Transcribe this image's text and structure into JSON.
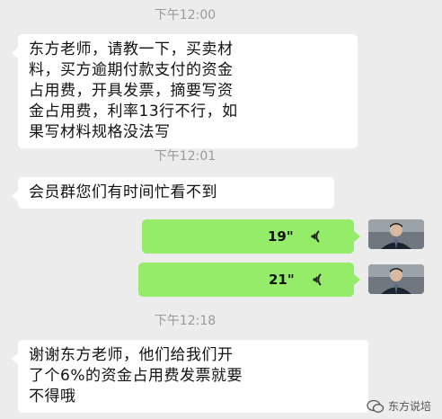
{
  "messages": [
    {
      "type": "time",
      "text": "下午12:00"
    },
    {
      "type": "text_in",
      "lines": [
        "东方老师，请教一下，买卖材",
        "料，买方逾期付款支付的资金",
        "占用费，开具发票，摘要写资",
        "金占用费，利率13行不行，如",
        "果写材料规格没法写"
      ]
    },
    {
      "type": "time",
      "text": "下午12:01"
    },
    {
      "type": "text_in",
      "lines": [
        "会员群您们有时间忙看不到"
      ]
    },
    {
      "type": "voice_out",
      "duration": "19\""
    },
    {
      "type": "voice_out",
      "duration": "21\""
    },
    {
      "type": "time",
      "text": "下午12:18"
    },
    {
      "type": "text_in",
      "lines": [
        "谢谢东方老师，他们给我们开",
        "了个6%的资金占用费发票就要",
        "不得哦"
      ]
    }
  ],
  "watermark": {
    "text": "东方说培",
    "icon": "wechat-official-icon"
  },
  "colors": {
    "background": "#ececec",
    "incoming": "#ffffff",
    "outgoing": "#95ec69"
  }
}
